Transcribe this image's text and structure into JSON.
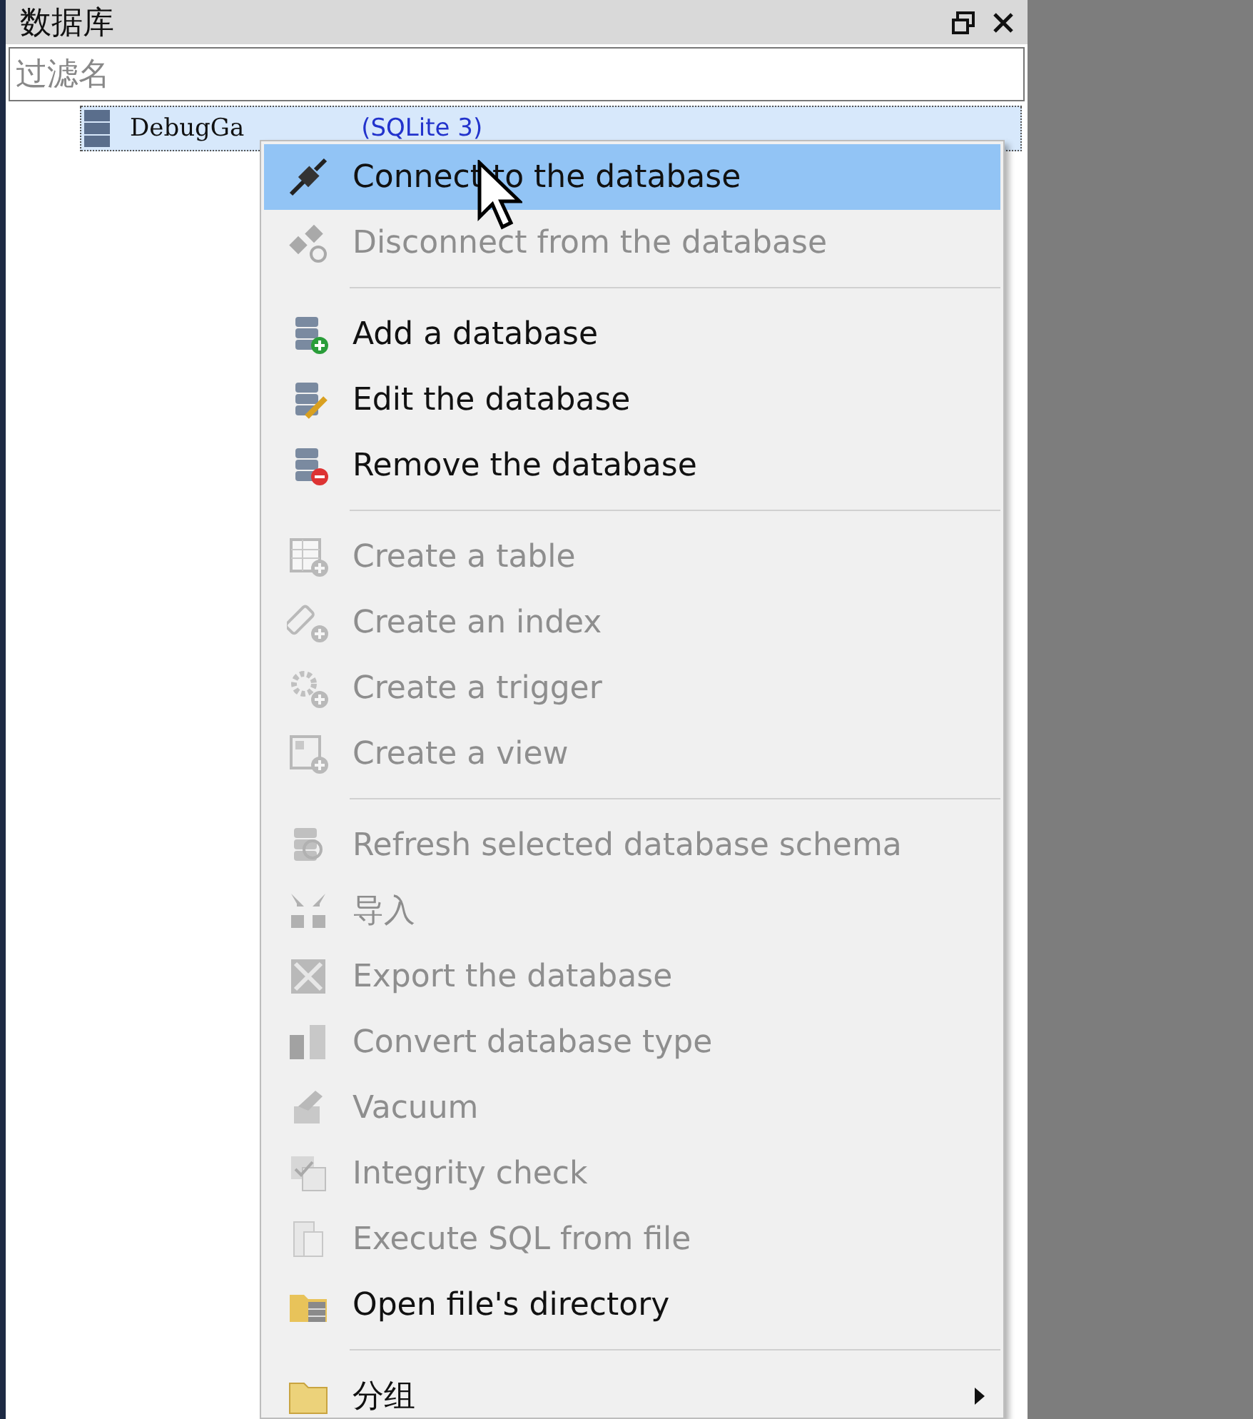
{
  "panel": {
    "title": "数据库",
    "filter": {
      "placeholder": "过滤名"
    },
    "tree": [
      {
        "name": "DebugGa",
        "type": "(SQLite 3)",
        "selected": true
      }
    ]
  },
  "context_menu": [
    {
      "kind": "item",
      "label": "Connect to the database",
      "disabled": false,
      "selected": true
    },
    {
      "kind": "item",
      "label": "Disconnect from the database",
      "disabled": true,
      "selected": false
    },
    {
      "kind": "separator"
    },
    {
      "kind": "item",
      "label": "Add a database",
      "disabled": false,
      "selected": false
    },
    {
      "kind": "item",
      "label": "Edit the database",
      "disabled": false,
      "selected": false
    },
    {
      "kind": "item",
      "label": "Remove the database",
      "disabled": false,
      "selected": false
    },
    {
      "kind": "separator"
    },
    {
      "kind": "item",
      "label": "Create a table",
      "disabled": true,
      "selected": false
    },
    {
      "kind": "item",
      "label": "Create an index",
      "disabled": true,
      "selected": false
    },
    {
      "kind": "item",
      "label": "Create a trigger",
      "disabled": true,
      "selected": false
    },
    {
      "kind": "item",
      "label": "Create a view",
      "disabled": true,
      "selected": false
    },
    {
      "kind": "separator"
    },
    {
      "kind": "item",
      "label": "Refresh selected database schema",
      "disabled": true,
      "selected": false
    },
    {
      "kind": "item",
      "label": "导入",
      "disabled": true,
      "selected": false
    },
    {
      "kind": "item",
      "label": "Export the database",
      "disabled": true,
      "selected": false
    },
    {
      "kind": "item",
      "label": "Convert database type",
      "disabled": true,
      "selected": false
    },
    {
      "kind": "item",
      "label": "Vacuum",
      "disabled": true,
      "selected": false
    },
    {
      "kind": "item",
      "label": "Integrity check",
      "disabled": true,
      "selected": false
    },
    {
      "kind": "item",
      "label": "Execute SQL from file",
      "disabled": true,
      "selected": false
    },
    {
      "kind": "item",
      "label": "Open file's directory",
      "disabled": false,
      "selected": false
    },
    {
      "kind": "separator"
    },
    {
      "kind": "submenu",
      "label": "分组",
      "disabled": false,
      "selected": false
    }
  ]
}
